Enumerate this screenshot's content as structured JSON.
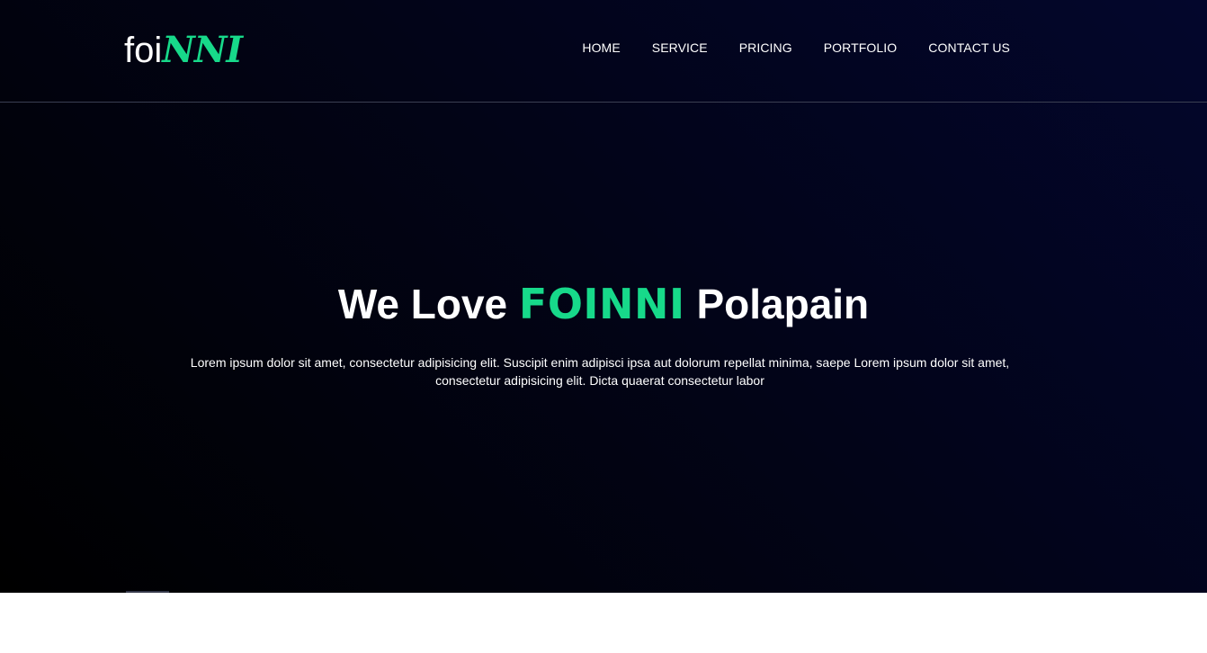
{
  "header": {
    "logo": {
      "plain": "foi",
      "accent": "NNI"
    },
    "nav": [
      {
        "label": "HOME"
      },
      {
        "label": "SERVICE"
      },
      {
        "label": "PRICING"
      },
      {
        "label": "PORTFOLIO"
      },
      {
        "label": "CONTACT US"
      }
    ]
  },
  "hero": {
    "headline": {
      "before": "We Love",
      "brand": "FOINNI",
      "after": "Polapain"
    },
    "description": "Lorem ipsum dolor sit amet, consectetur adipisicing elit. Suscipit enim adipisci ipsa aut dolorum repellat minima, saepe Lorem ipsum dolor sit amet, consectetur adipisicing elit. Dicta quaerat consectetur labor"
  },
  "colors": {
    "accent": "#17d98a",
    "text": "#ffffff",
    "hero_dark": "#000000",
    "hero_navy": "#03062c",
    "page_background": "#ffffff"
  }
}
